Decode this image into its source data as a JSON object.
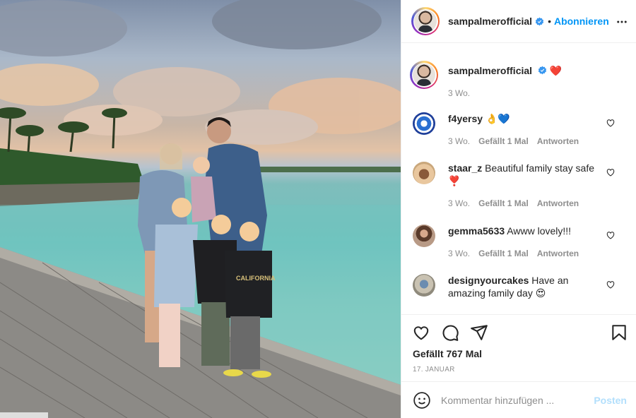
{
  "photo": {
    "alt_icon": "family-photo",
    "tag": ""
  },
  "post": {
    "username": "sampalmerofficial",
    "follow_label": "Abonnieren",
    "separator": "•",
    "caption_emoji": "❤️",
    "caption_time": "3 Wo."
  },
  "comments": [
    {
      "user": "f4yersy",
      "text": "👌💙",
      "time": "3 Wo.",
      "likes": "Gefällt 1 Mal",
      "reply": "Antworten"
    },
    {
      "user": "staar_z",
      "text": "Beautiful family stay safe ❣️",
      "time": "3 Wo.",
      "likes": "Gefällt 1 Mal",
      "reply": "Antworten"
    },
    {
      "user": "gemma5633",
      "text": "Awww lovely!!!",
      "time": "3 Wo.",
      "likes": "Gefällt 1 Mal",
      "reply": "Antworten"
    },
    {
      "user": "designyourcakes",
      "text": "Have an amazing family day 😍",
      "time": "",
      "likes": "",
      "reply": ""
    }
  ],
  "stats": {
    "likes_label": "Gefällt 767 Mal",
    "date": "17. JANUAR"
  },
  "composer": {
    "placeholder": "Kommentar hinzufügen ...",
    "post_label": "Posten"
  },
  "colors": {
    "accent": "#0095f6",
    "post_disabled": "#b2dffc",
    "muted": "#8e8e8e",
    "text": "#262626"
  }
}
